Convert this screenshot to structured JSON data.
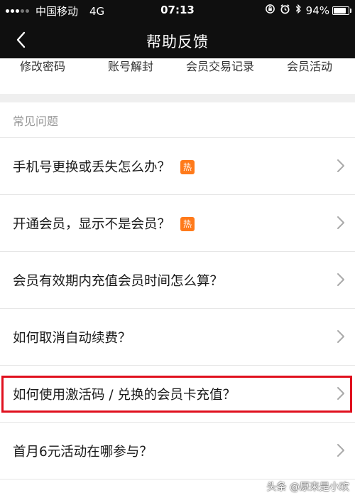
{
  "status_bar": {
    "carrier": "中国移动",
    "network": "4G",
    "time": "07:13",
    "battery_percent": "94%",
    "battery_level": 0.94,
    "icons": [
      "orientation-lock-icon",
      "alarm-icon",
      "bluetooth-icon"
    ]
  },
  "nav": {
    "back_icon": "chevron-left-icon",
    "title": "帮助反馈"
  },
  "quick_tabs": [
    "修改密码",
    "账号解封",
    "会员交易记录",
    "会员活动"
  ],
  "faq": {
    "section_title": "常见问题",
    "items": [
      {
        "text": "手机号更换或丢失怎么办？",
        "hot": "热"
      },
      {
        "text": "开通会员，显示不是会员？",
        "hot": "热"
      },
      {
        "text": "会员有效期内充值会员时间怎么算？"
      },
      {
        "text": "如何取消自动续费？"
      },
      {
        "text": "如何使用激活码 / 兑换的会员卡充值？"
      },
      {
        "text": "首月6元活动在哪参与？"
      }
    ],
    "highlighted_index": 4,
    "highlight_color": "#e0101e",
    "hot_badge_color": "#ff7a1a"
  },
  "watermark": "头条 @原来是小欢"
}
